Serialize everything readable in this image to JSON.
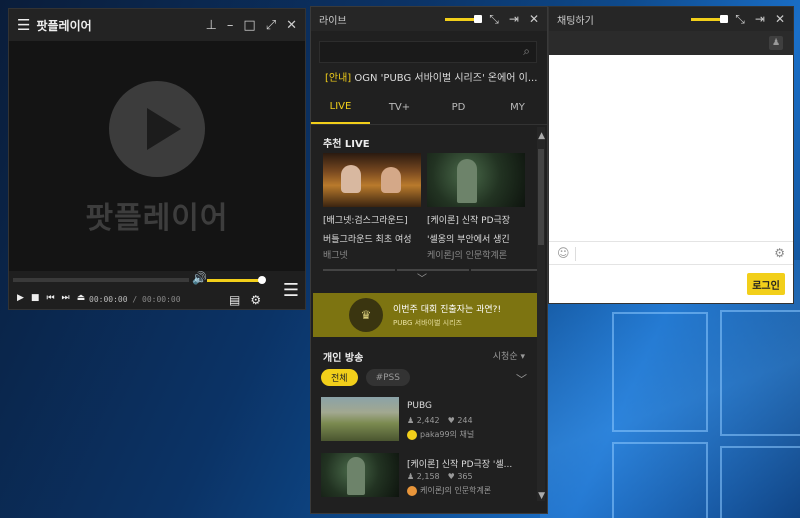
{
  "player": {
    "title": "팟플레이어",
    "logo_text": "팟플레이어",
    "time_current": "00:00:00",
    "time_separator": "/",
    "time_total": "00:00:00",
    "volume_level": 0.95,
    "icons": {
      "menu": "hamburger-icon",
      "pin": "pin-icon",
      "minimize": "minimize-icon",
      "maximize": "maximize-icon",
      "fullscreen": "fullscreen-icon",
      "close": "close-icon"
    }
  },
  "live": {
    "title": "라이브",
    "search_placeholder": "",
    "notice_tag": "[안내]",
    "notice_text": " OGN 'PUBG 서바이벌 시리즈' 온에어 이...",
    "tabs": [
      "LIVE",
      "TV+",
      "PD",
      "MY"
    ],
    "active_tab": "LIVE",
    "recommended_title": "추천 LIVE",
    "recommended": [
      {
        "title": "[배그넷:검스그라운드]",
        "subtitle": "버틀그라운드 최초 여성",
        "channel": "배그넷"
      },
      {
        "title": "[케이론] 신작 PD극장",
        "subtitle": "'셀옹의 부안에서 생긴",
        "channel": "케이론J의 인문학계론"
      }
    ],
    "banner_main": "이번주 대회 진출자는 과연?!",
    "banner_sub": "PUBG 서바이벌 시리즈",
    "personal_title": "개인 방송",
    "sort_label": "시청순 ▾",
    "chips": [
      "전체",
      "#PSS"
    ],
    "broadcasts": [
      {
        "title": "PUBG",
        "viewers": "2,442",
        "likes": "244",
        "channel": "paka99의 채널"
      },
      {
        "title": "[케이론] 신작 PD극장 '셀...",
        "viewers": "2,158",
        "likes": "365",
        "channel": "케이론J의 인문학계론"
      }
    ]
  },
  "chat": {
    "title": "채팅하기",
    "input_placeholder": "",
    "login_label": "로그인"
  },
  "accent_color": "#f2cf1a"
}
